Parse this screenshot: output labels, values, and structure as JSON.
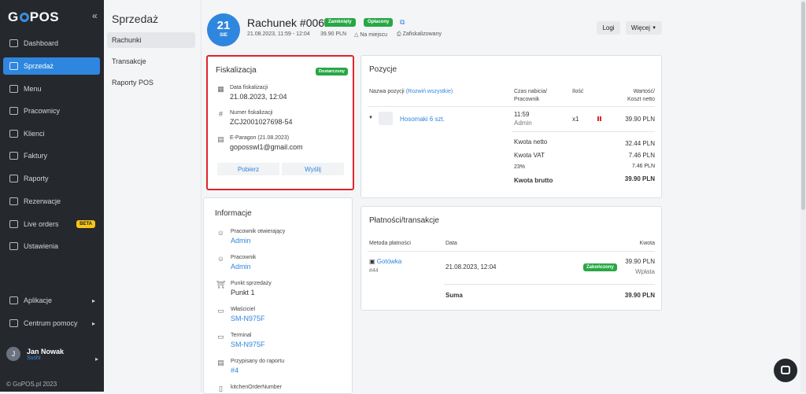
{
  "brand": {
    "name_before": "G",
    "name_after": "POS",
    "collapse_icon": "«"
  },
  "sidebar": {
    "items": [
      {
        "label": "Dashboard",
        "icon": "dashboard-icon"
      },
      {
        "label": "Sprzedaż",
        "icon": "sales-icon",
        "active": true
      },
      {
        "label": "Menu",
        "icon": "menu-icon"
      },
      {
        "label": "Pracownicy",
        "icon": "employees-icon"
      },
      {
        "label": "Klienci",
        "icon": "clients-icon"
      },
      {
        "label": "Faktury",
        "icon": "invoices-icon"
      },
      {
        "label": "Raporty",
        "icon": "reports-icon"
      },
      {
        "label": "Rezerwacje",
        "icon": "reservations-icon"
      },
      {
        "label": "Live orders",
        "icon": "live-orders-icon",
        "badge": "BETA"
      },
      {
        "label": "Ustawienia",
        "icon": "settings-icon"
      }
    ],
    "bottom_items": [
      {
        "label": "Aplikacje",
        "icon": "apps-icon"
      },
      {
        "label": "Centrum pomocy",
        "icon": "help-icon"
      }
    ],
    "user": {
      "initial": "J",
      "name": "Jan Nowak",
      "venue": "Sushi"
    },
    "footer": "© GoPOS.pl 2023"
  },
  "subnav": {
    "title": "Sprzedaż",
    "items": [
      "Rachunki",
      "Transakcje",
      "Raporty POS"
    ]
  },
  "header": {
    "day": "21",
    "month": "SIE",
    "title": "Rachunek #0062",
    "badges": [
      "Zamknięty",
      "Opłacony"
    ],
    "datetime": "21.08.2023, 11:59 - 12:04",
    "amount": "39.90 PLN",
    "location": "Na miejscu",
    "fiscal_status": "Zafiskalizowany",
    "btn_logs": "Logi",
    "btn_more": "Więcej"
  },
  "fiskalizacja": {
    "title": "Fiskalizacja",
    "status": "Dostarczony",
    "date_label": "Data fiskalizacji",
    "date_value": "21.08.2023, 12:04",
    "number_label": "Numer fiskalizacji",
    "number_value": "ZCJ2001027698-54",
    "eparagon_label": "E-Paragon (21.08.2023)",
    "eparagon_value": "goposswl1@gmail.com",
    "btn_download": "Pobierz",
    "btn_send": "Wyślij"
  },
  "informacje": {
    "title": "Informacje",
    "rows": [
      {
        "label": "Pracownik otwierający",
        "value": "Admin",
        "link": true
      },
      {
        "label": "Pracownik",
        "value": "Admin",
        "link": true
      },
      {
        "label": "Punkt sprzedaży",
        "value": "Punkt 1",
        "link": false
      },
      {
        "label": "Właściciel",
        "value": "SM-N975F",
        "link": true
      },
      {
        "label": "Terminal",
        "value": "SM-N975F",
        "link": true
      },
      {
        "label": "Przypisany do raportu",
        "value": "#4",
        "link": true
      },
      {
        "label": "kitchenOrderNumber",
        "value": "",
        "link": false
      }
    ]
  },
  "pozycje": {
    "title": "Pozycje",
    "col_name": "Nazwa pozycji",
    "expand_all": "(Rozwiń wszystkie)",
    "col_time_1": "Czas nabicia/",
    "col_time_2": "Pracownik",
    "col_qty": "Ilość",
    "col_value_1": "Wartość/",
    "col_value_2": "Koszt netto",
    "item": {
      "name": "Hosomaki 6 szt.",
      "time": "11:59",
      "employee": "Admin",
      "qty": "x1",
      "value": "39.90 PLN"
    },
    "totals": [
      {
        "label": "Kwota netto",
        "value": "32.44 PLN"
      },
      {
        "label": "Kwota VAT",
        "value": "7.46 PLN"
      },
      {
        "label": "23%",
        "value": "7.46 PLN"
      },
      {
        "label": "Kwota brutto",
        "value": "39.90 PLN"
      }
    ]
  },
  "platnosci": {
    "title": "Płatności/transakcje",
    "col_method": "Metoda płatności",
    "col_date": "Data",
    "col_amount": "Kwota",
    "row": {
      "method": "Gotówka",
      "id": "#44",
      "date": "21.08.2023, 12:04",
      "status": "Zakończony",
      "amount": "39.90 PLN",
      "type": "Wpłata"
    },
    "sum_label": "Suma",
    "sum_value": "39.90 PLN"
  },
  "colors": {
    "accent": "#2f86de",
    "success": "#28a745",
    "danger": "#e0252a",
    "sidebar": "#25282d"
  }
}
